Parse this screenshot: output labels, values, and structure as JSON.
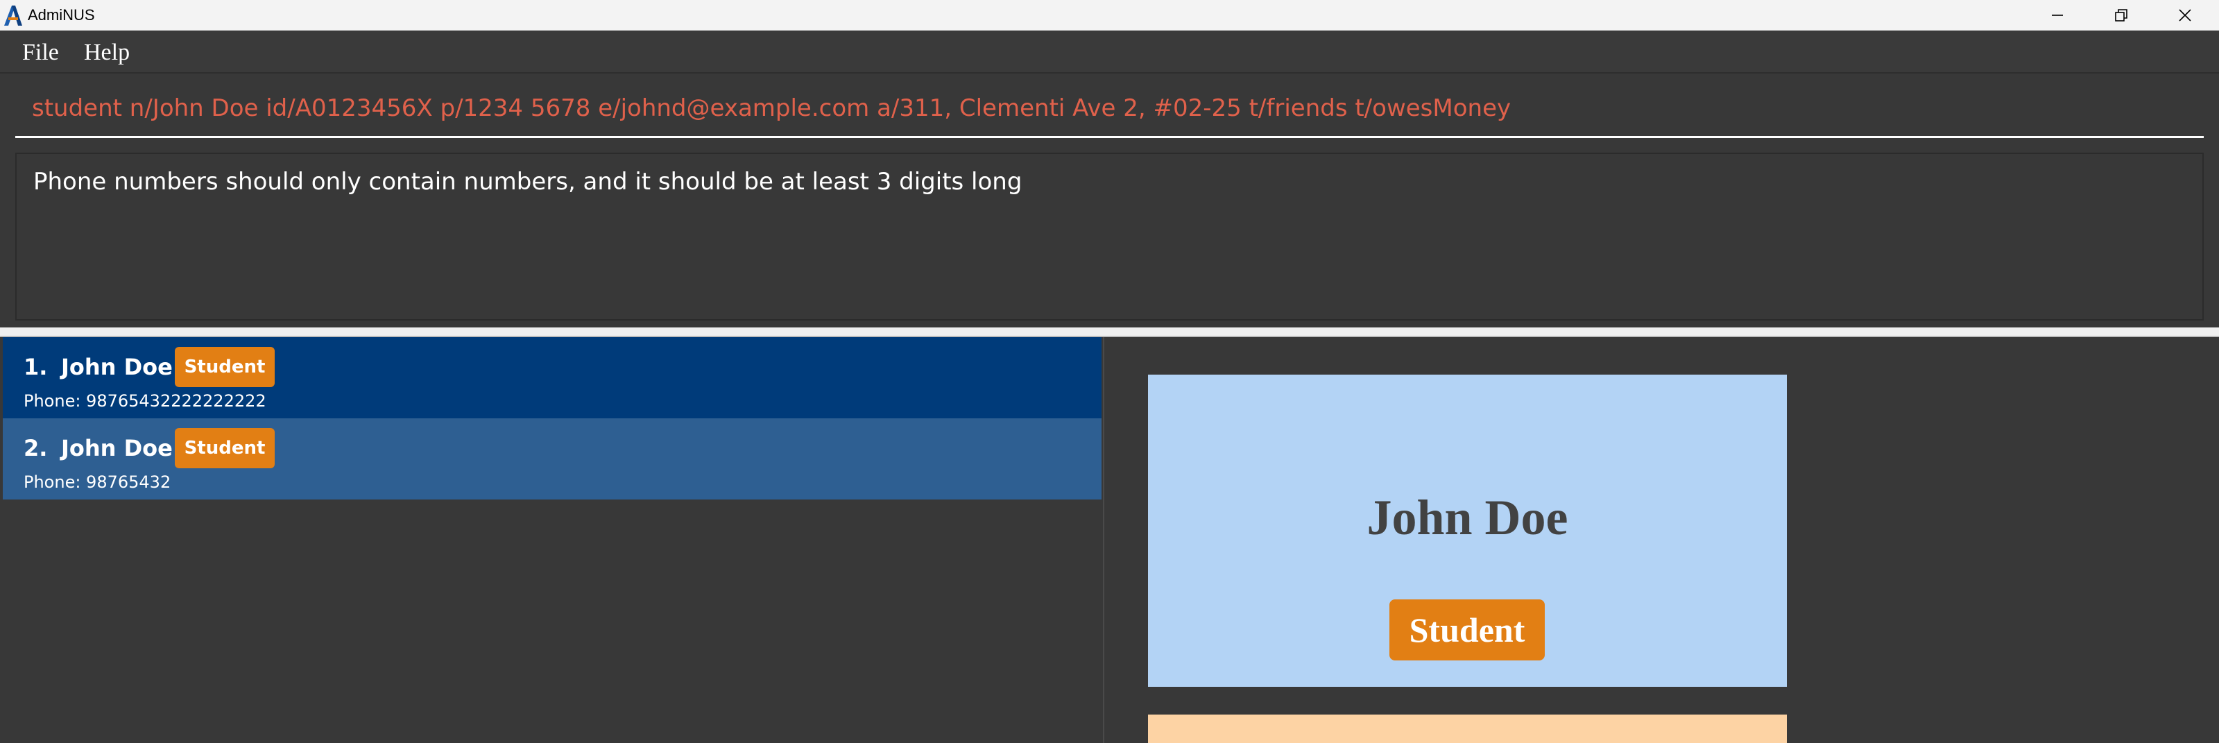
{
  "window": {
    "title": "AdmiNUS",
    "controls": {
      "minimize": "minimize-icon",
      "restore": "restore-icon",
      "close": "close-icon"
    }
  },
  "menu": {
    "items": [
      {
        "label": "File"
      },
      {
        "label": "Help"
      }
    ]
  },
  "command": {
    "value": "student n/John Doe id/A0123456X p/1234 5678 e/johnd@example.com a/311, Clementi Ave 2, #02-25 t/friends t/owesMoney",
    "color": "#e0614b"
  },
  "result": {
    "message": "Phone numbers should only contain numbers, and it should be at least 3 digits long"
  },
  "persons": [
    {
      "index": "1.",
      "name": "John Doe",
      "tag": "Student",
      "phone": "Phone: 98765432222222222",
      "selected": true
    },
    {
      "index": "2.",
      "name": "John Doe",
      "tag": "Student",
      "phone": "Phone: 98765432",
      "selected": false
    }
  ],
  "detail": {
    "name": "John Doe",
    "tag": "Student"
  },
  "colors": {
    "background": "#383838",
    "selected_card": "#003b7a",
    "card": "#2e5f92",
    "tag": "#e27f14",
    "profile_card": "#b3d3f5",
    "secondary_card": "#fdd3a4"
  }
}
